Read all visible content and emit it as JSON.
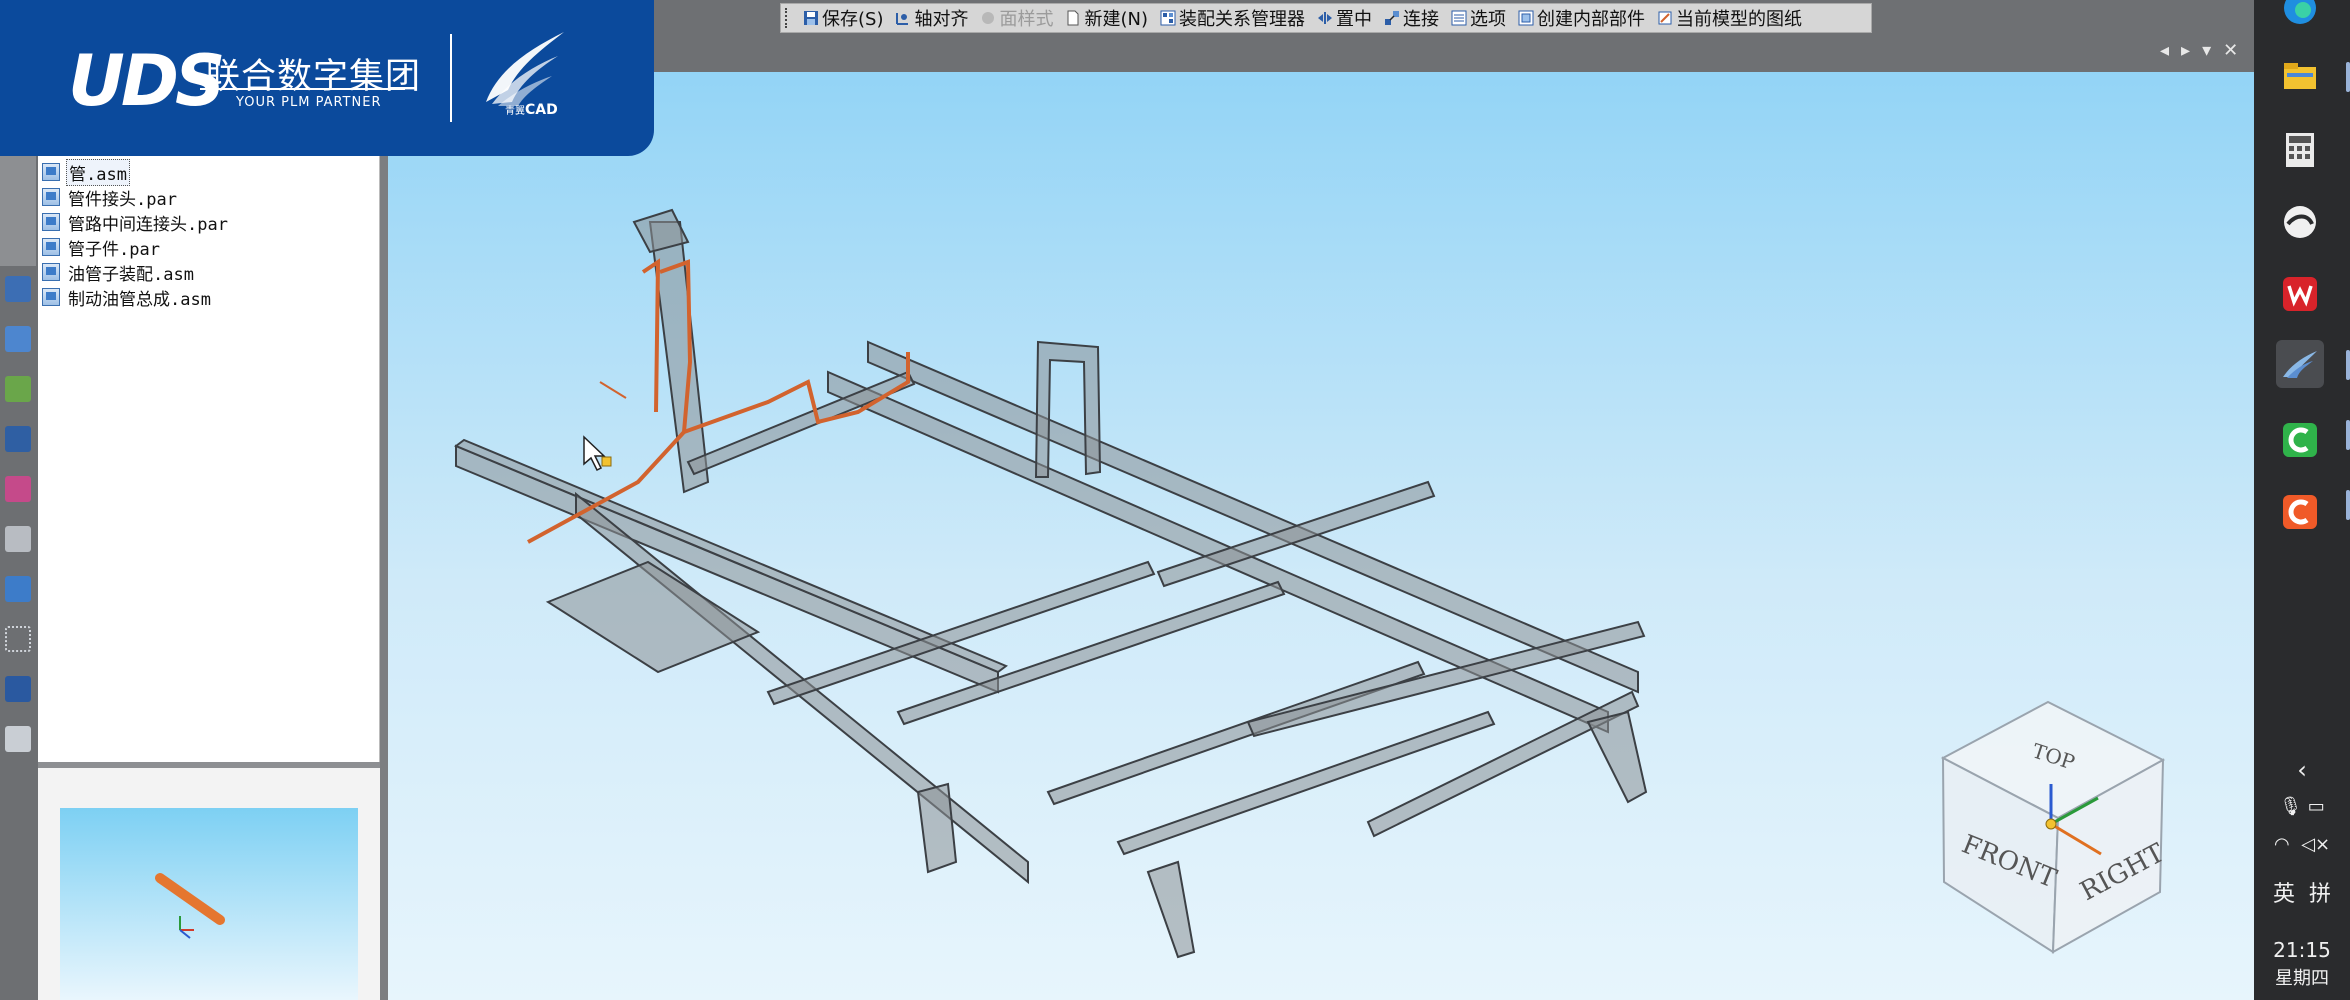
{
  "logo": {
    "brand": "UDS",
    "company_cn": "联合数字集团",
    "tagline": "YOUR PLM PARTNER",
    "product": "CAD",
    "product_prefix": "青翼"
  },
  "toolbar": {
    "items": [
      {
        "label": "保存(S)",
        "icon": "save-icon",
        "enabled": true
      },
      {
        "label": "轴对齐",
        "icon": "axis-align-icon",
        "enabled": true
      },
      {
        "label": "面样式",
        "icon": "face-style-icon",
        "enabled": false
      },
      {
        "label": "新建(N)",
        "icon": "new-doc-icon",
        "enabled": true
      },
      {
        "label": "装配关系管理器",
        "icon": "assembly-manager-icon",
        "enabled": true
      },
      {
        "label": "置中",
        "icon": "center-icon",
        "enabled": true
      },
      {
        "label": "连接",
        "icon": "connect-icon",
        "enabled": true
      },
      {
        "label": "选项",
        "icon": "options-icon",
        "enabled": true
      },
      {
        "label": "创建内部部件",
        "icon": "create-part-icon",
        "enabled": true
      },
      {
        "label": "当前模型的图纸",
        "icon": "drawing-icon",
        "enabled": true
      }
    ]
  },
  "tree": {
    "items": [
      {
        "label": "管.asm",
        "selected": true
      },
      {
        "label": "管件接头.par",
        "selected": false
      },
      {
        "label": "管路中间连接头.par",
        "selected": false
      },
      {
        "label": "管子件.par",
        "selected": false
      },
      {
        "label": "油管子装配.asm",
        "selected": false
      },
      {
        "label": "制动油管总成.asm",
        "selected": false
      }
    ]
  },
  "viewcube": {
    "top": "TOP",
    "front": "FRONT",
    "right": "RIGHT"
  },
  "taskbar": {
    "time": "21:15",
    "weekday": "星期四",
    "ime_lang": "英",
    "ime_mode": "拼"
  },
  "colors": {
    "brand_blue": "#0b4a9c",
    "pipe_orange": "#d2632e",
    "frame_gray": "#8c9196"
  }
}
